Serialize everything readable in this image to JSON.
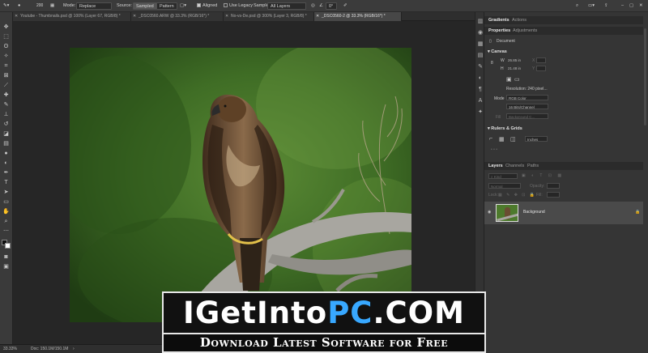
{
  "options_bar": {
    "brush_size": "200",
    "mode_label": "Mode:",
    "mode_value": "Replace",
    "source_label": "Source:",
    "source_sampled": "Sampled",
    "source_pattern": "Pattern",
    "aligned_label": "Aligned",
    "legacy_label": "Use Legacy",
    "sample_label": "Sample:",
    "sample_value": "All Layers",
    "angle_value": "0°"
  },
  "tabs": [
    {
      "label": "Youtube - Thumbnails.psd @ 100% (Layer 67, RGB/8) *"
    },
    {
      "label": "_DSC0560.ARW @ 33.3% (RGB/16*) *"
    },
    {
      "label": "No-vs-De.psd @ 300% (Layer 3, RGB/8) *"
    },
    {
      "label": "_DSC0560-2 @ 33.3% (RGB/16*) *"
    }
  ],
  "status_bar": {
    "zoom": "33.33%",
    "doc_size": "Doc: 150.1M/150.1M"
  },
  "top_panel": {
    "tab_gradients": "Gradients",
    "tab_actions": "Actions"
  },
  "properties_panel": {
    "tab_properties": "Properties",
    "tab_adjustments": "Adjustments",
    "document_label": "Document",
    "canvas_section": "Canvas",
    "width_label": "W",
    "width_value": "26.85 in",
    "height_label": "H",
    "height_value": "21.48 in",
    "x_label": "X",
    "y_label": "Y",
    "resolution": "Resolution: 240 pixel...",
    "mode_label": "Mode",
    "mode_value": "RGB Color",
    "bits_value": "16 Bits/Channel",
    "fill_label": "Fill",
    "fill_value": "Background C...",
    "rulers_section": "Rulers & Grids",
    "units_value": "Inches"
  },
  "layers_panel": {
    "tab_layers": "Layers",
    "tab_channels": "Channels",
    "tab_paths": "Paths",
    "kind_placeholder": "Kind",
    "blend_mode": "Normal",
    "opacity_label": "Opacity:",
    "lock_label": "Lock:",
    "fill_label": "Fill:",
    "layer_name": "Background"
  },
  "watermark": {
    "brand_white": "IGetInto",
    "brand_blue": "PC",
    "brand_tld": ".COM",
    "tagline": "Download Latest Software for Free"
  },
  "colors": {
    "accent_blue": "#38a8ff",
    "panel_bg": "#353535",
    "canvas_bg": "#262626"
  }
}
